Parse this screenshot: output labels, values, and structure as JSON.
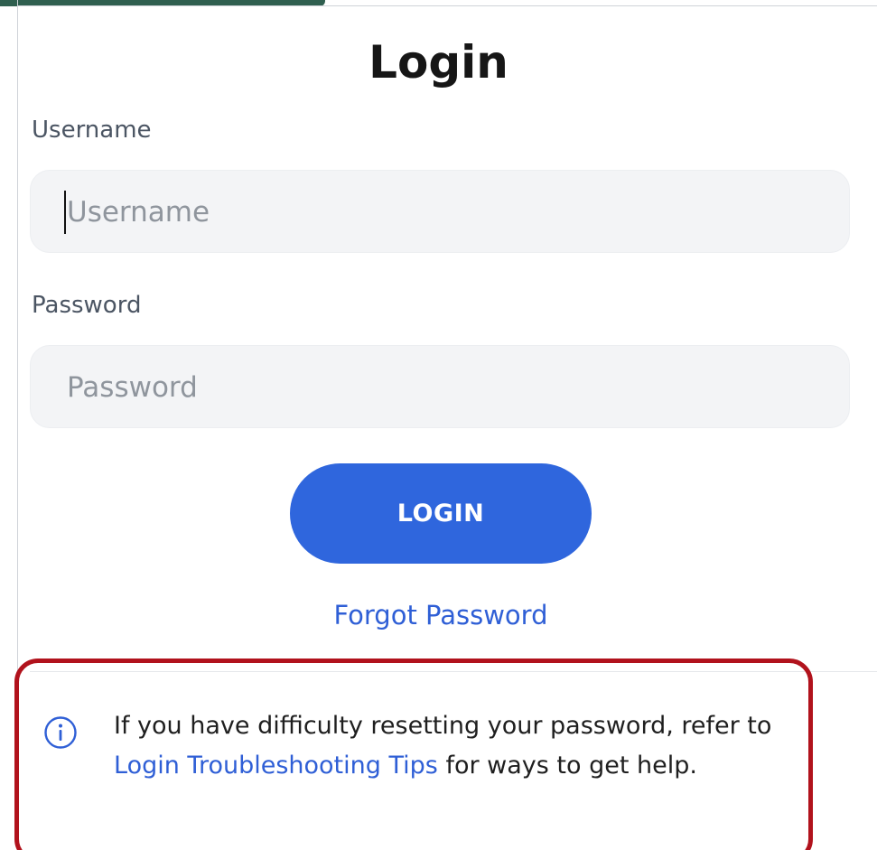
{
  "title": "Login",
  "username": {
    "label": "Username",
    "placeholder": "Username",
    "value": ""
  },
  "password": {
    "label": "Password",
    "placeholder": "Password",
    "value": ""
  },
  "login_button": "LOGIN",
  "forgot_password": "Forgot Password",
  "info": {
    "icon": "info-icon",
    "text_before": "If you have difficulty resetting your password, refer to ",
    "link": "Login Troubleshooting Tips",
    "text_after": " for ways to get help."
  },
  "colors": {
    "primary": "#2f66dd",
    "link": "#2f5fd6",
    "highlight_border": "#b1121c",
    "header": "#2f5f4f"
  }
}
